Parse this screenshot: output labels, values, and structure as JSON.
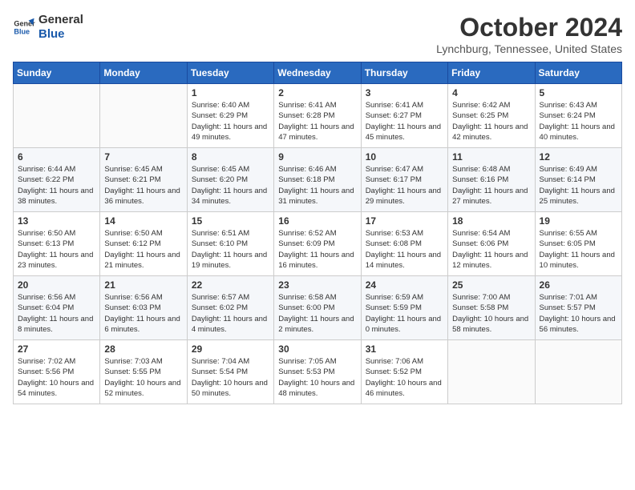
{
  "logo": {
    "line1": "General",
    "line2": "Blue"
  },
  "title": "October 2024",
  "location": "Lynchburg, Tennessee, United States",
  "days_of_week": [
    "Sunday",
    "Monday",
    "Tuesday",
    "Wednesday",
    "Thursday",
    "Friday",
    "Saturday"
  ],
  "weeks": [
    [
      {
        "day": "",
        "info": ""
      },
      {
        "day": "",
        "info": ""
      },
      {
        "day": "1",
        "info": "Sunrise: 6:40 AM\nSunset: 6:29 PM\nDaylight: 11 hours and 49 minutes."
      },
      {
        "day": "2",
        "info": "Sunrise: 6:41 AM\nSunset: 6:28 PM\nDaylight: 11 hours and 47 minutes."
      },
      {
        "day": "3",
        "info": "Sunrise: 6:41 AM\nSunset: 6:27 PM\nDaylight: 11 hours and 45 minutes."
      },
      {
        "day": "4",
        "info": "Sunrise: 6:42 AM\nSunset: 6:25 PM\nDaylight: 11 hours and 42 minutes."
      },
      {
        "day": "5",
        "info": "Sunrise: 6:43 AM\nSunset: 6:24 PM\nDaylight: 11 hours and 40 minutes."
      }
    ],
    [
      {
        "day": "6",
        "info": "Sunrise: 6:44 AM\nSunset: 6:22 PM\nDaylight: 11 hours and 38 minutes."
      },
      {
        "day": "7",
        "info": "Sunrise: 6:45 AM\nSunset: 6:21 PM\nDaylight: 11 hours and 36 minutes."
      },
      {
        "day": "8",
        "info": "Sunrise: 6:45 AM\nSunset: 6:20 PM\nDaylight: 11 hours and 34 minutes."
      },
      {
        "day": "9",
        "info": "Sunrise: 6:46 AM\nSunset: 6:18 PM\nDaylight: 11 hours and 31 minutes."
      },
      {
        "day": "10",
        "info": "Sunrise: 6:47 AM\nSunset: 6:17 PM\nDaylight: 11 hours and 29 minutes."
      },
      {
        "day": "11",
        "info": "Sunrise: 6:48 AM\nSunset: 6:16 PM\nDaylight: 11 hours and 27 minutes."
      },
      {
        "day": "12",
        "info": "Sunrise: 6:49 AM\nSunset: 6:14 PM\nDaylight: 11 hours and 25 minutes."
      }
    ],
    [
      {
        "day": "13",
        "info": "Sunrise: 6:50 AM\nSunset: 6:13 PM\nDaylight: 11 hours and 23 minutes."
      },
      {
        "day": "14",
        "info": "Sunrise: 6:50 AM\nSunset: 6:12 PM\nDaylight: 11 hours and 21 minutes."
      },
      {
        "day": "15",
        "info": "Sunrise: 6:51 AM\nSunset: 6:10 PM\nDaylight: 11 hours and 19 minutes."
      },
      {
        "day": "16",
        "info": "Sunrise: 6:52 AM\nSunset: 6:09 PM\nDaylight: 11 hours and 16 minutes."
      },
      {
        "day": "17",
        "info": "Sunrise: 6:53 AM\nSunset: 6:08 PM\nDaylight: 11 hours and 14 minutes."
      },
      {
        "day": "18",
        "info": "Sunrise: 6:54 AM\nSunset: 6:06 PM\nDaylight: 11 hours and 12 minutes."
      },
      {
        "day": "19",
        "info": "Sunrise: 6:55 AM\nSunset: 6:05 PM\nDaylight: 11 hours and 10 minutes."
      }
    ],
    [
      {
        "day": "20",
        "info": "Sunrise: 6:56 AM\nSunset: 6:04 PM\nDaylight: 11 hours and 8 minutes."
      },
      {
        "day": "21",
        "info": "Sunrise: 6:56 AM\nSunset: 6:03 PM\nDaylight: 11 hours and 6 minutes."
      },
      {
        "day": "22",
        "info": "Sunrise: 6:57 AM\nSunset: 6:02 PM\nDaylight: 11 hours and 4 minutes."
      },
      {
        "day": "23",
        "info": "Sunrise: 6:58 AM\nSunset: 6:00 PM\nDaylight: 11 hours and 2 minutes."
      },
      {
        "day": "24",
        "info": "Sunrise: 6:59 AM\nSunset: 5:59 PM\nDaylight: 11 hours and 0 minutes."
      },
      {
        "day": "25",
        "info": "Sunrise: 7:00 AM\nSunset: 5:58 PM\nDaylight: 10 hours and 58 minutes."
      },
      {
        "day": "26",
        "info": "Sunrise: 7:01 AM\nSunset: 5:57 PM\nDaylight: 10 hours and 56 minutes."
      }
    ],
    [
      {
        "day": "27",
        "info": "Sunrise: 7:02 AM\nSunset: 5:56 PM\nDaylight: 10 hours and 54 minutes."
      },
      {
        "day": "28",
        "info": "Sunrise: 7:03 AM\nSunset: 5:55 PM\nDaylight: 10 hours and 52 minutes."
      },
      {
        "day": "29",
        "info": "Sunrise: 7:04 AM\nSunset: 5:54 PM\nDaylight: 10 hours and 50 minutes."
      },
      {
        "day": "30",
        "info": "Sunrise: 7:05 AM\nSunset: 5:53 PM\nDaylight: 10 hours and 48 minutes."
      },
      {
        "day": "31",
        "info": "Sunrise: 7:06 AM\nSunset: 5:52 PM\nDaylight: 10 hours and 46 minutes."
      },
      {
        "day": "",
        "info": ""
      },
      {
        "day": "",
        "info": ""
      }
    ]
  ]
}
